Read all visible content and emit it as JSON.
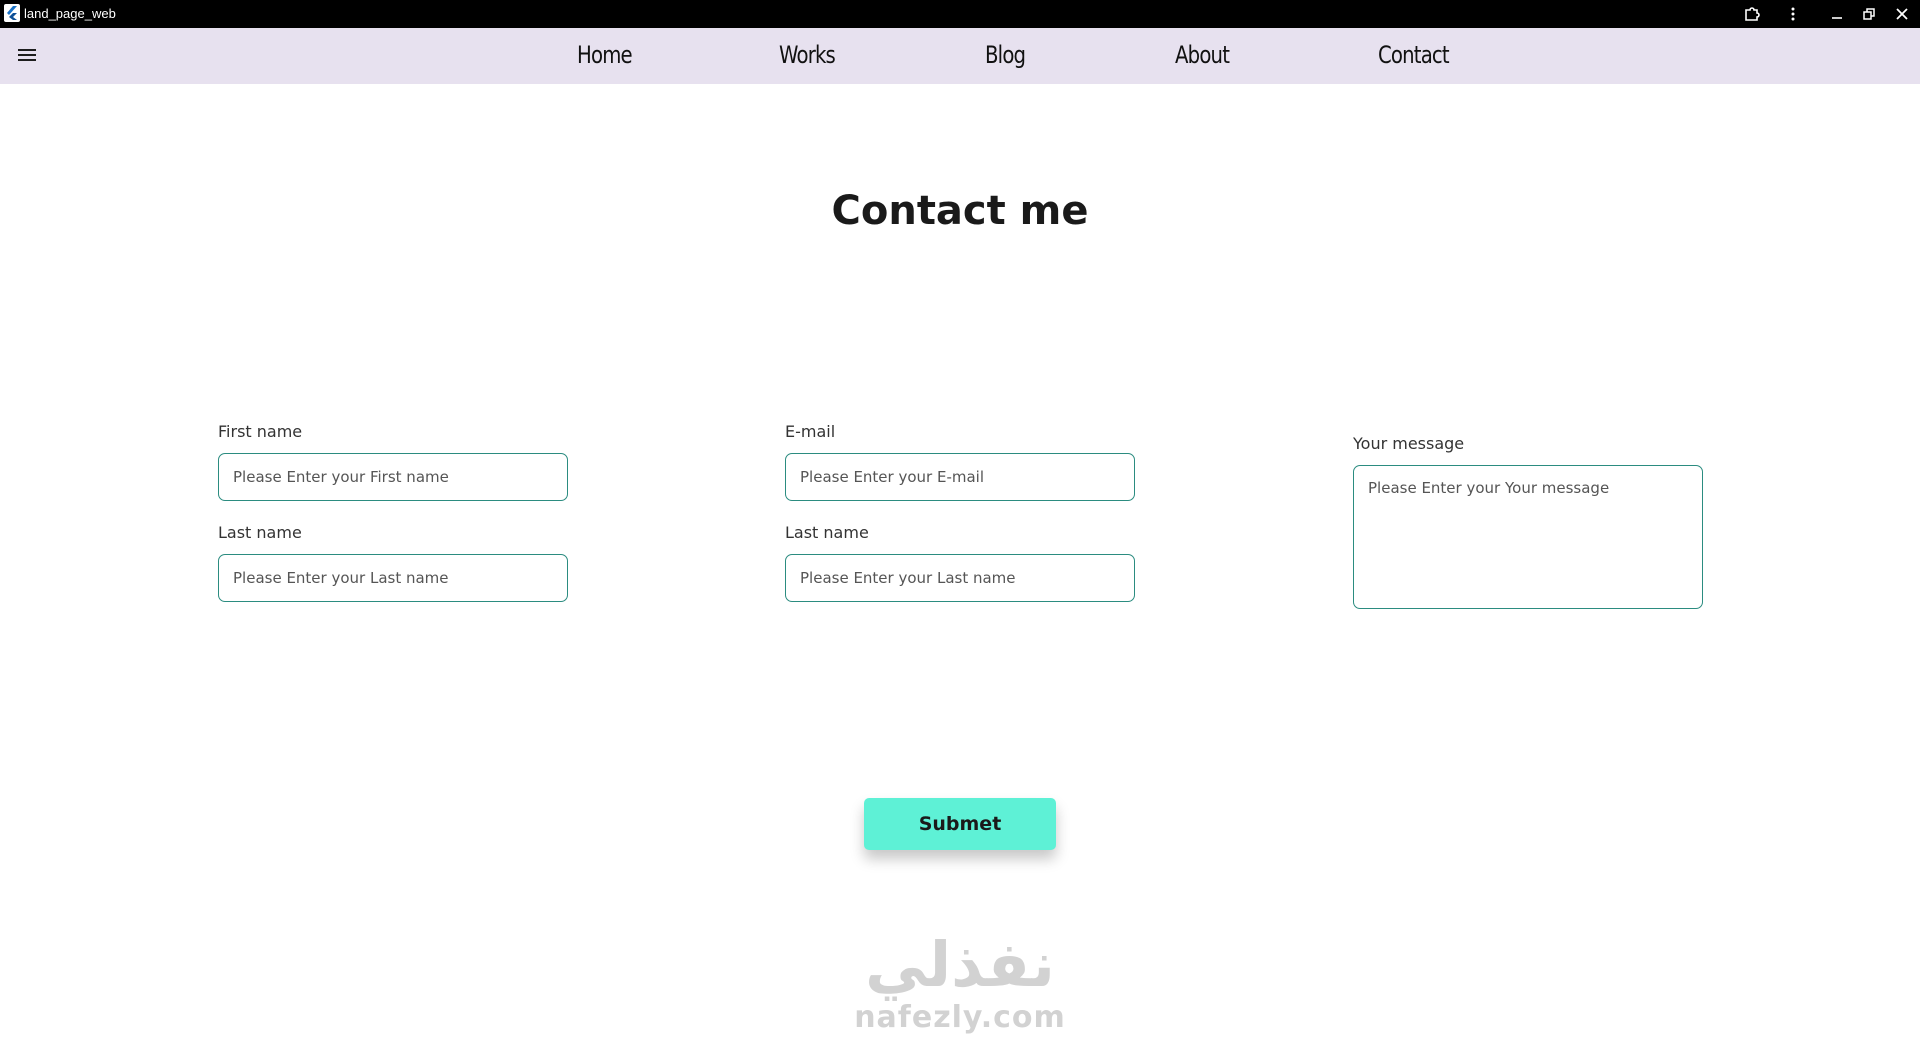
{
  "window": {
    "title": "land_page_web"
  },
  "nav": {
    "items": [
      "Home",
      "Works",
      "Blog",
      "About",
      "Contact"
    ]
  },
  "page": {
    "heading": "Contact me"
  },
  "form": {
    "first_name": {
      "label": "First name",
      "placeholder": "Please Enter your First name"
    },
    "last_name_left": {
      "label": "Last name",
      "placeholder": "Please Enter your Last name"
    },
    "email": {
      "label": "E-mail",
      "placeholder": "Please Enter your E-mail"
    },
    "last_name_mid": {
      "label": "Last name",
      "placeholder": "Please Enter your Last name"
    },
    "message": {
      "label": "Your message",
      "placeholder": "Please Enter your Your message"
    },
    "submit_label": "Submet"
  },
  "watermark": {
    "arabic": "نفذلي",
    "latin": "nafezly.com"
  },
  "colors": {
    "titlebar": "#000000",
    "navbar": "#e7e1ef",
    "input_border": "#2b8c80",
    "submit_bg": "#5ef1d6",
    "watermark": "#d2d2d2"
  },
  "icons": {
    "app": "flutter-logo-icon",
    "extension": "puzzle-icon",
    "more": "more-vertical-icon",
    "minimize": "minimize-icon",
    "restore": "restore-icon",
    "close": "close-icon",
    "menu": "hamburger-menu-icon"
  }
}
